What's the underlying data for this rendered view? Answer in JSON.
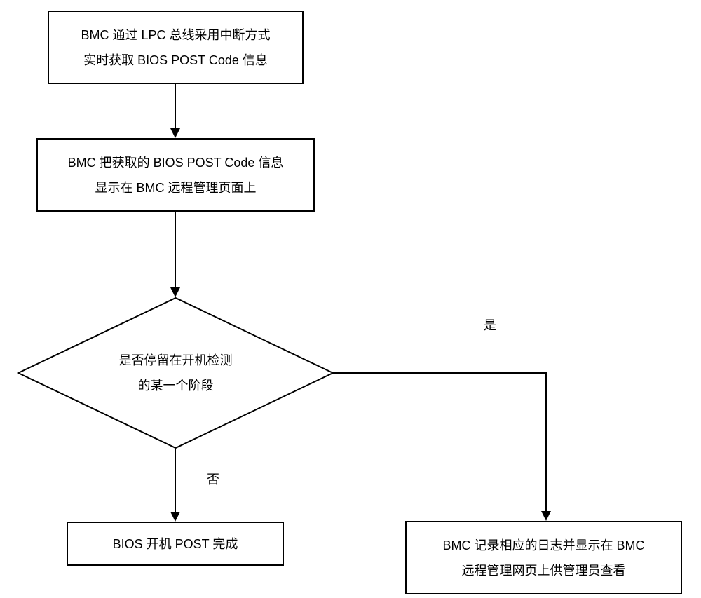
{
  "flowchart": {
    "step1_line1": "BMC 通过 LPC 总线采用中断方式",
    "step1_line2": "实时获取 BIOS POST Code 信息",
    "step2_line1": "BMC 把获取的 BIOS POST Code 信息",
    "step2_line2": "显示在 BMC 远程管理页面上",
    "decision_line1": "是否停留在开机检测",
    "decision_line2": "的某一个阶段",
    "step3_no": "BIOS 开机 POST 完成",
    "step3_yes_line1": "BMC 记录相应的日志并显示在 BMC",
    "step3_yes_line2": "远程管理网页上供管理员查看",
    "label_yes": "是",
    "label_no": "否"
  }
}
